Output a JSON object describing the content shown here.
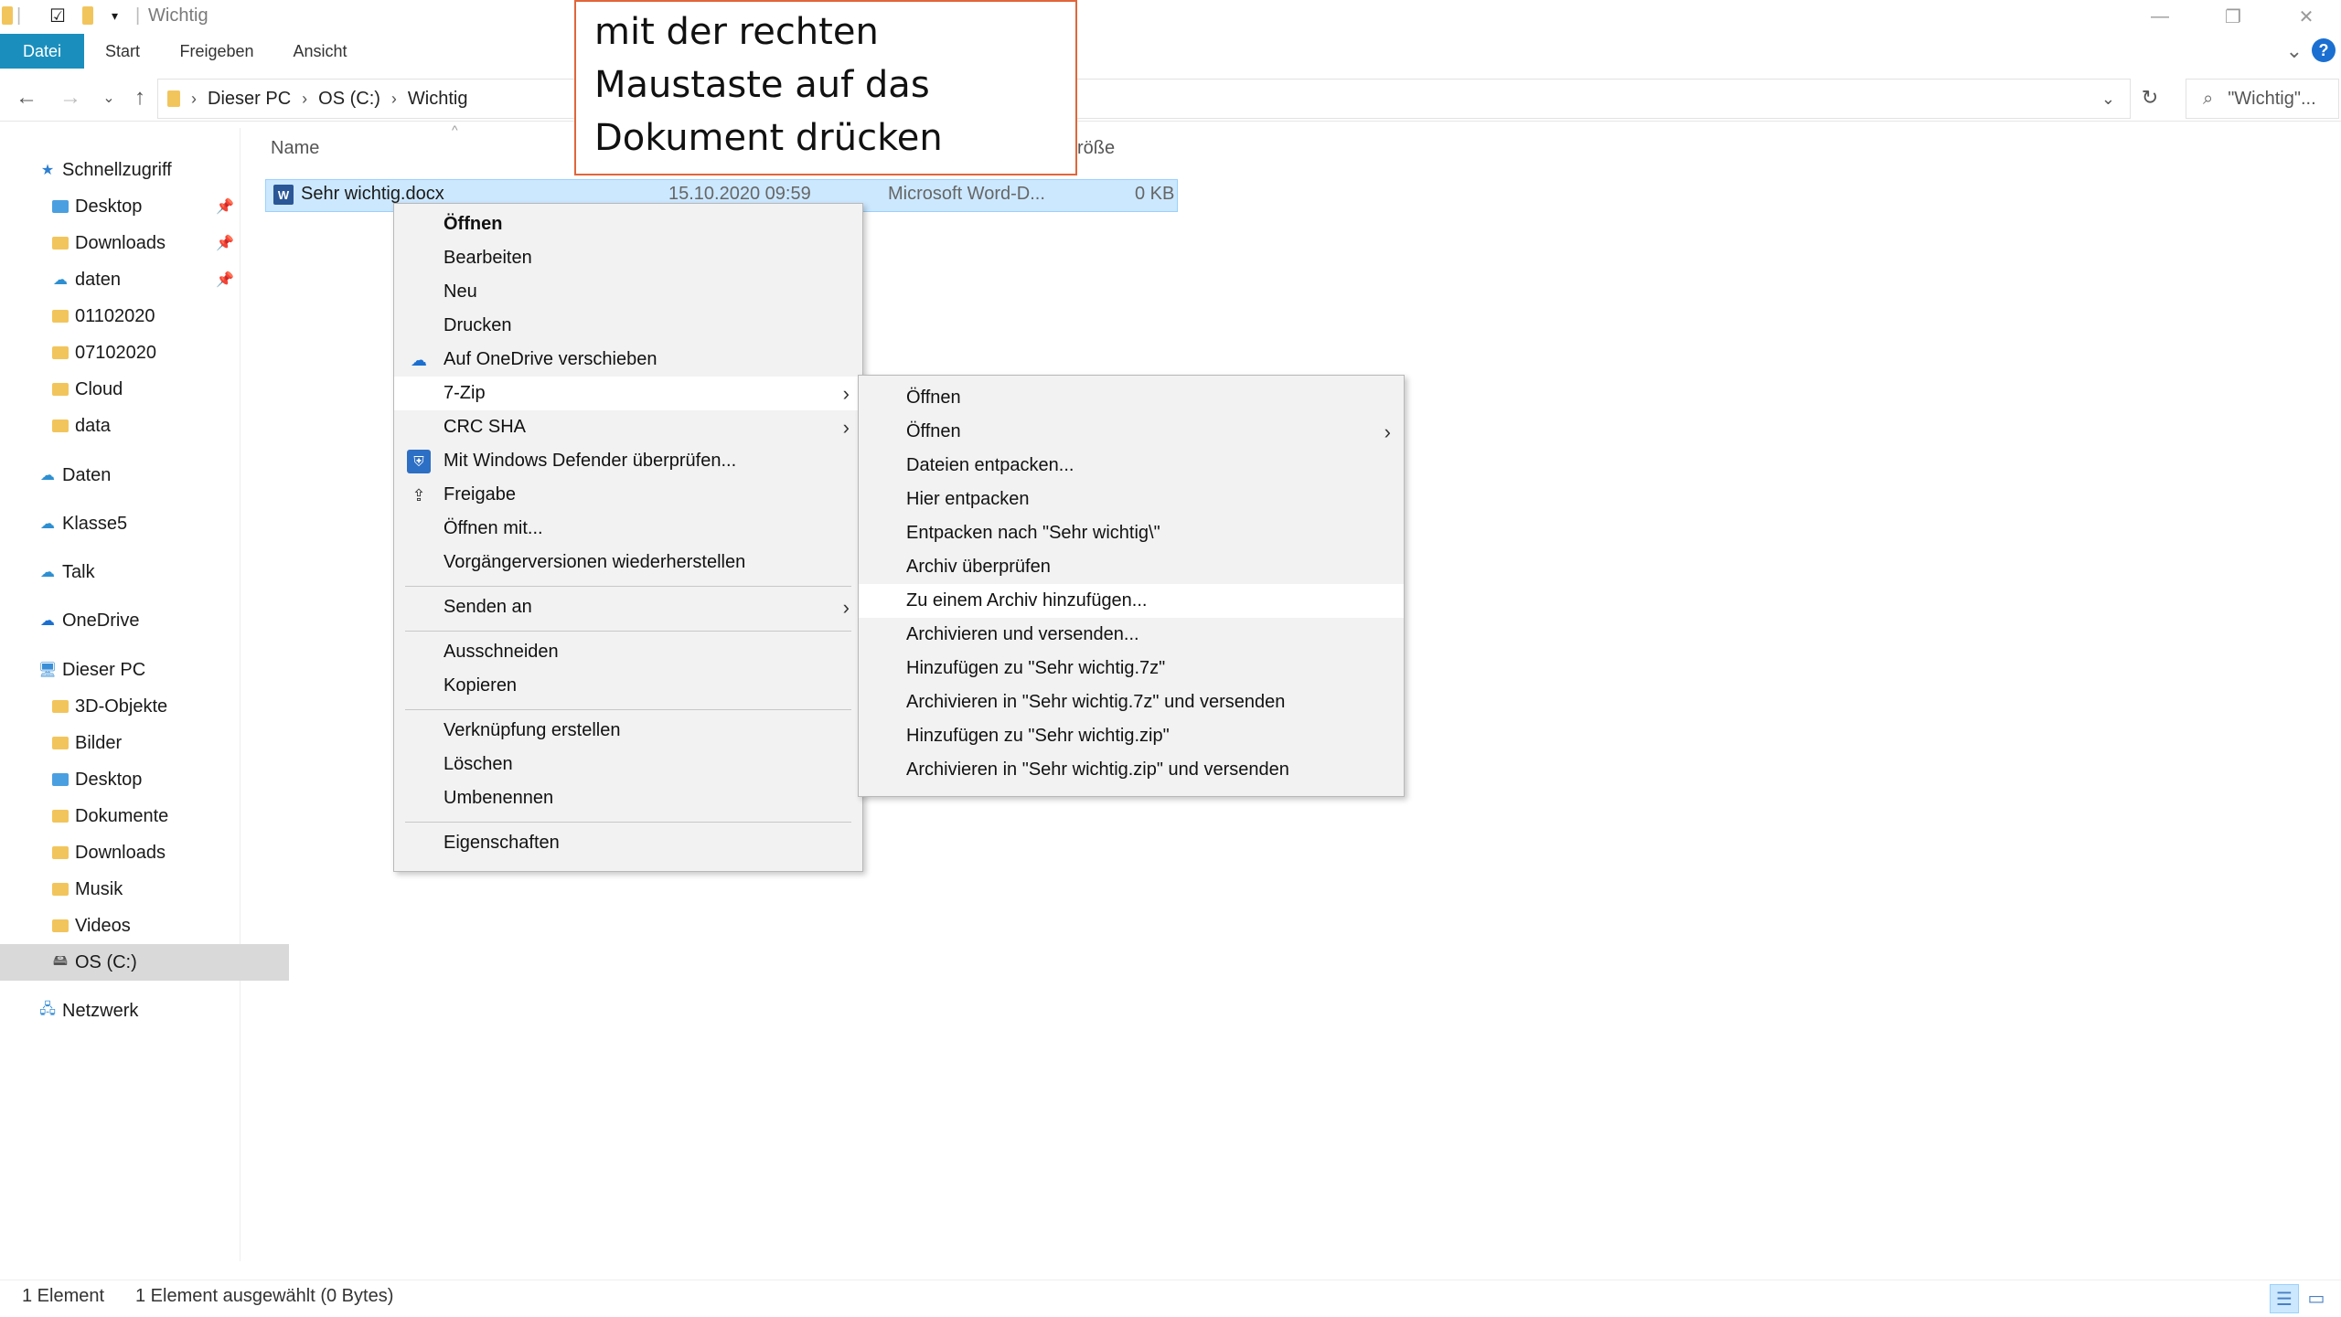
{
  "window": {
    "title": "Wichtig",
    "controls": {
      "minimize": "—",
      "restore": "❐",
      "close": "✕"
    }
  },
  "ribbon": {
    "tabs": [
      {
        "label": "Datei",
        "active": true
      },
      {
        "label": "Start"
      },
      {
        "label": "Freigeben"
      },
      {
        "label": "Ansicht"
      }
    ],
    "help": "?"
  },
  "address": {
    "breadcrumbs": [
      "Dieser PC",
      "OS (C:)",
      "Wichtig"
    ],
    "search_placeholder": "\"Wichtig\"..."
  },
  "nav": {
    "quick_access": "Schnellzugriff",
    "items": [
      {
        "label": "Desktop",
        "pinned": true
      },
      {
        "label": "Downloads",
        "pinned": true
      },
      {
        "label": "daten",
        "pinned": true
      },
      {
        "label": "01102020"
      },
      {
        "label": "07102020"
      },
      {
        "label": "Cloud"
      },
      {
        "label": "data"
      }
    ],
    "locations": [
      "Daten",
      "Klasse5",
      "Talk",
      "OneDrive"
    ],
    "this_pc": "Dieser PC",
    "pc_items": [
      "3D-Objekte",
      "Bilder",
      "Desktop",
      "Dokumente",
      "Downloads",
      "Musik",
      "Videos",
      "OS (C:)"
    ],
    "network": "Netzwerk"
  },
  "columns": {
    "name": "Name",
    "size": "röße"
  },
  "file": {
    "name": "Sehr wichtig.docx",
    "date": "15.10.2020 09:59",
    "type": "Microsoft Word-D...",
    "size": "0 KB"
  },
  "context_menu": {
    "items": [
      "Öffnen",
      "Bearbeiten",
      "Neu",
      "Drucken",
      "Auf OneDrive verschieben",
      "7-Zip",
      "CRC SHA",
      "Mit Windows Defender überprüfen...",
      "Freigabe",
      "Öffnen mit...",
      "Vorgängerversionen wiederherstellen",
      "Senden an",
      "Ausschneiden",
      "Kopieren",
      "Verknüpfung erstellen",
      "Löschen",
      "Umbenennen",
      "Eigenschaften"
    ]
  },
  "zip_menu": {
    "items": [
      "Öffnen",
      "Öffnen",
      "Dateien entpacken...",
      "Hier entpacken",
      "Entpacken nach \"Sehr wichtig\\\"",
      "Archiv überprüfen",
      "Zu einem Archiv hinzufügen...",
      "Archivieren und versenden...",
      "Hinzufügen zu \"Sehr wichtig.7z\"",
      "Archivieren in \"Sehr wichtig.7z\" und versenden",
      "Hinzufügen zu \"Sehr wichtig.zip\"",
      "Archivieren in \"Sehr wichtig.zip\" und versenden"
    ]
  },
  "callout": {
    "lines": [
      "mit der rechten",
      "Maustaste auf das",
      "Dokument drücken"
    ]
  },
  "status": {
    "count": "1 Element",
    "selection": "1 Element ausgewählt (0 Bytes)"
  },
  "colors": {
    "accent": "#1a8fbd",
    "selection": "#cce8ff",
    "callout_border": "#e0663a"
  }
}
